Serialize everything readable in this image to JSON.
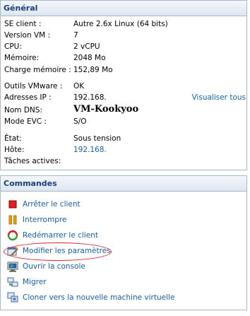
{
  "general": {
    "title": "Général",
    "rows": [
      {
        "label": "SE client :",
        "value": "Autre 2.6x Linux (64 bits)"
      },
      {
        "label": "Version VM :",
        "value": "7"
      },
      {
        "label": "CPU:",
        "value": "2 vCPU"
      },
      {
        "label": "Mémoire:",
        "value": "2048 Mo"
      },
      {
        "label": "Charge mémoire :",
        "value": "152,89 Mo"
      },
      {
        "label": "Outils VMware :",
        "value": "OK"
      },
      {
        "label": "Adresses IP :",
        "value": "192.168."
      },
      {
        "label": "Nom DNS:",
        "value": "VM-Kookyoo"
      },
      {
        "label": "Mode EVC :",
        "value": "S/O"
      },
      {
        "label": "État:",
        "value": "Sous tension"
      },
      {
        "label": "Hôte:",
        "value": "192.168."
      },
      {
        "label": "Tâches actives:",
        "value": ""
      }
    ],
    "view_all_link": "Visualiser tous"
  },
  "commands": {
    "title": "Commandes",
    "items": [
      {
        "label": "Arrêter le client",
        "icon": "stop-icon"
      },
      {
        "label": "Interrompre",
        "icon": "pause-icon"
      },
      {
        "label": "Redémarrer le client",
        "icon": "restart-icon"
      },
      {
        "label": "Modifier les paramètres",
        "icon": "edit-settings-icon"
      },
      {
        "label": "Ouvrir la console",
        "icon": "console-icon"
      },
      {
        "label": "Migrer",
        "icon": "migrate-icon"
      },
      {
        "label": "Cloner vers la nouvelle machine virtuelle",
        "icon": "clone-icon"
      }
    ]
  },
  "colors": {
    "link": "#1560a8",
    "header_text": "#1a3f77",
    "highlight": "#d8242a",
    "stop": "#e02020",
    "pause": "#f0a000"
  }
}
